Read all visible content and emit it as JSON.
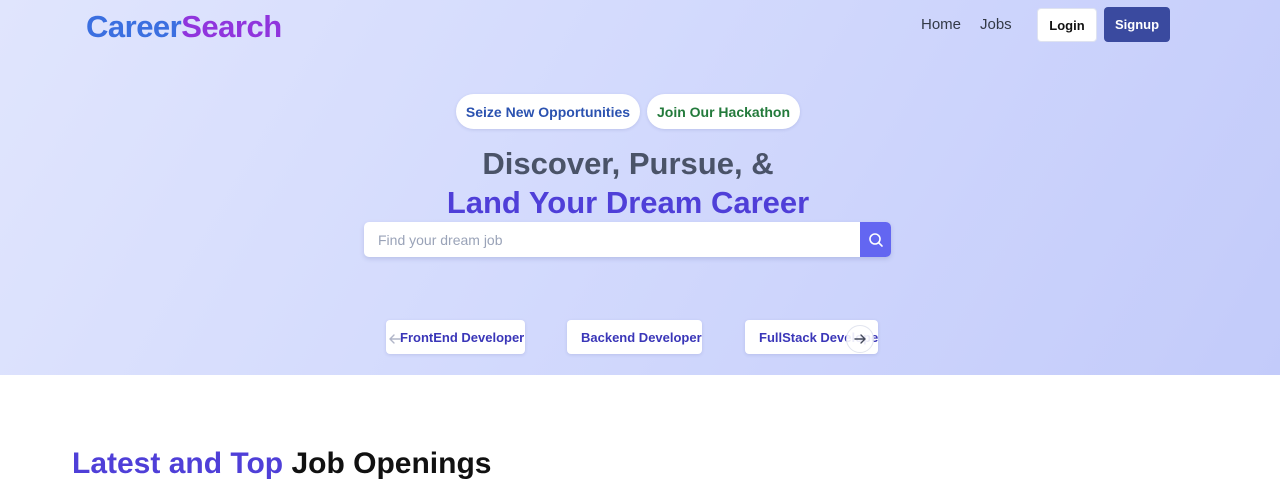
{
  "header": {
    "logo_part1": "Career",
    "logo_part2": "Search",
    "nav": {
      "home": "Home",
      "jobs": "Jobs"
    },
    "login_label": "Login",
    "signup_label": "Signup"
  },
  "hero": {
    "pill_opportunities": "Seize New Opportunities",
    "pill_hackathon": "Join Our Hackathon",
    "headline_line1": "Discover, Pursue, &",
    "headline_line2": "Land Your Dream Career",
    "search": {
      "placeholder": "Find your dream job",
      "value": ""
    },
    "categories": [
      "FrontEnd Developer",
      "Backend Developer",
      "FullStack Developer"
    ]
  },
  "jobs_section": {
    "title_highlight": "Latest and Top",
    "title_rest": "Job Openings"
  },
  "colors": {
    "accent": "#4f3fd8",
    "signup": "#3a4a9f",
    "search_button": "#6366f1"
  },
  "icons": {
    "search": "search-icon",
    "prev": "arrow-left-icon",
    "next": "arrow-right-icon"
  }
}
